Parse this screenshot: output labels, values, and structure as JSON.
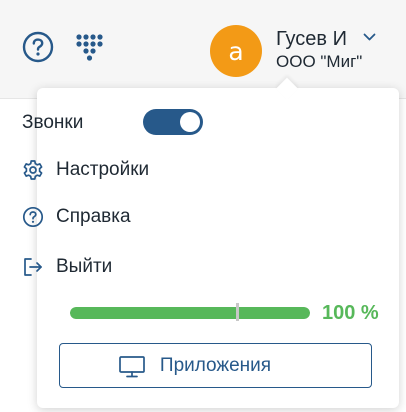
{
  "header": {
    "user": {
      "avatar_letter": "a",
      "name": "Гусев И",
      "organization": "ООО \"Миг\""
    },
    "icons": {
      "help": "help-circle-icon",
      "apps": "apps-grid-icon",
      "menu_toggle": "chevron-down-icon"
    }
  },
  "menu": {
    "calls_label": "Звонки",
    "calls_enabled": true,
    "items": [
      {
        "label": "Настройки",
        "icon": "gear-icon"
      },
      {
        "label": "Справка",
        "icon": "help-circle-icon"
      },
      {
        "label": "Выйти",
        "icon": "logout-icon"
      }
    ],
    "progress_value": 1.0,
    "progress_text": "100 %",
    "apps_button_label": "Приложения",
    "apps_button_icon": "monitor-icon"
  },
  "colors": {
    "accent": "#27598a",
    "avatar": "#f39a16",
    "progress": "#57b85a"
  }
}
